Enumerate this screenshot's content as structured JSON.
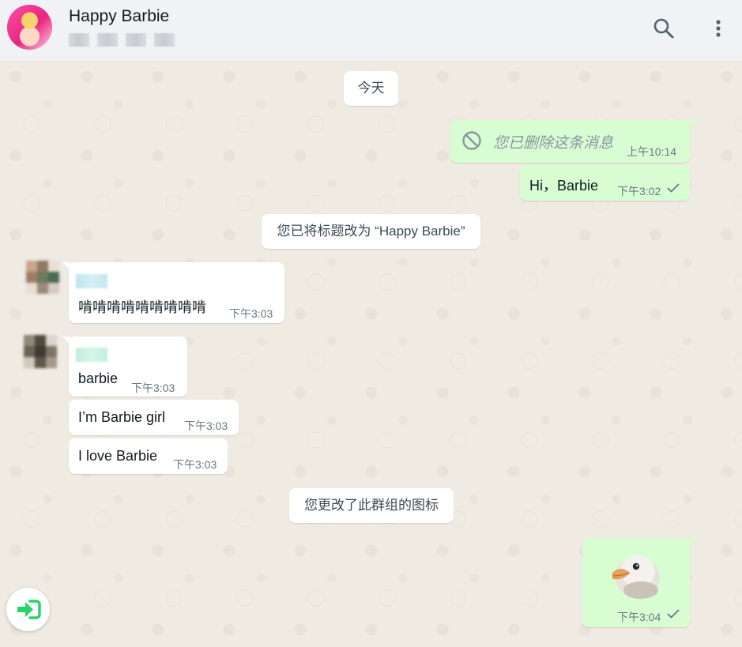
{
  "header": {
    "title": "Happy Barbie",
    "search_icon": "search-icon",
    "menu_icon": "more-vertical-icon"
  },
  "messages": {
    "date_pill": "今天",
    "deleted": {
      "text": "您已删除这条消息",
      "time": "上午10:14",
      "icon": "blocked-icon"
    },
    "hi": {
      "text": "Hi，Barbie",
      "time": "下午3:02"
    },
    "title_change": "您已将标题改为 “Happy Barbie”",
    "first_in": {
      "text": "啃啃啃啃啃啃啃啃啃",
      "time": "下午3:03"
    },
    "second_in": [
      {
        "text": "barbie",
        "time": "下午3:03"
      },
      {
        "text": "I’m Barbie girl",
        "time": "下午3:03"
      },
      {
        "text": "I love Barbie",
        "time": "下午3:03"
      }
    ],
    "icon_change": "您更改了此群组的图标",
    "sticker": {
      "time": "下午3:04",
      "icon": "bird-sticker"
    }
  },
  "colors": {
    "outgoing": "#d9fdd3",
    "incoming": "#ffffff",
    "background": "#efeae2",
    "accent": "#25d366"
  },
  "enter_button_icon": "enter-icon"
}
